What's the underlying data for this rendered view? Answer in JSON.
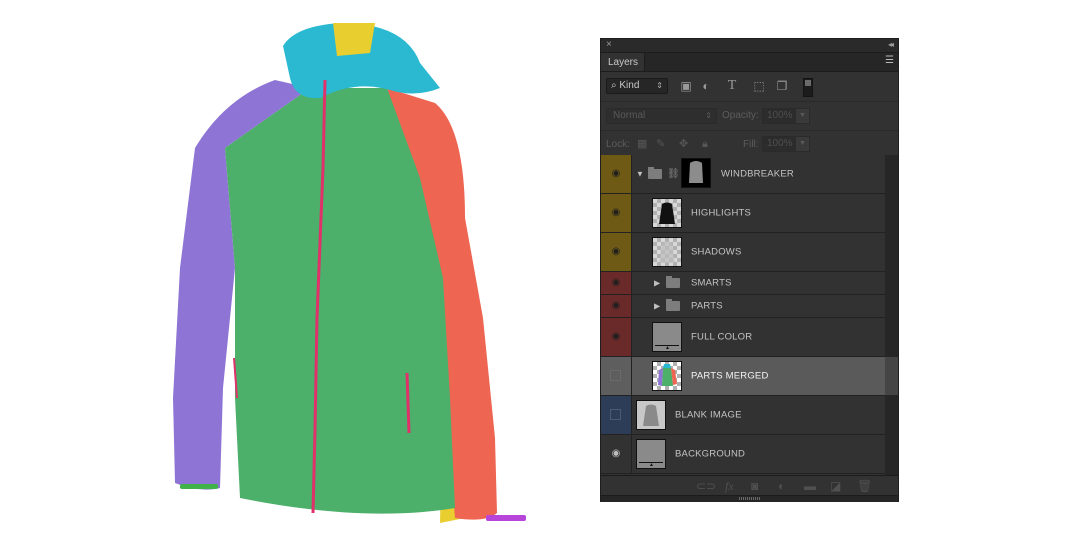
{
  "canvas": {
    "subject": "windbreaker-jacket-mockup",
    "part_colors": {
      "body": "#4CAF6A",
      "left_sleeve": "#8E74D4",
      "right_sleeve": "#EE6552",
      "hood": "#2BB9D2",
      "hood_panel": "#E8CE2E",
      "side_panel": "#E8CE2E",
      "zipper": "#E0316A",
      "cuff_left": "#3FB34A",
      "cuff_right": "#B745D9"
    }
  },
  "panel": {
    "close_icon": "×",
    "collapse_icon": "◂◂",
    "tab_label": "Layers",
    "menu_icon": "☰",
    "filter": {
      "kind_label": "Kind",
      "icons": [
        "image-filter-icon",
        "adjustment-filter-icon",
        "type-filter-icon",
        "shape-filter-icon",
        "smart-object-filter-icon"
      ]
    },
    "blend_mode": "Normal",
    "opacity_label": "Opacity:",
    "opacity_value": "100%",
    "lock_label": "Lock:",
    "fill_label": "Fill:",
    "fill_value": "100%",
    "layers": [
      {
        "name": "WINDBREAKER",
        "type": "group",
        "expanded": true,
        "visible": true,
        "color": "#6E5A14"
      },
      {
        "name": "HIGHLIGHTS",
        "type": "layer",
        "visible": true,
        "color": "#6E5A14"
      },
      {
        "name": "SHADOWS",
        "type": "layer",
        "visible": true,
        "color": "#6E5A14"
      },
      {
        "name": "SMARTS",
        "type": "group",
        "expanded": false,
        "visible": true,
        "color": "#6B2A2A"
      },
      {
        "name": "PARTS",
        "type": "group",
        "expanded": false,
        "visible": true,
        "color": "#6B2A2A"
      },
      {
        "name": "FULL COLOR",
        "type": "fill",
        "visible": true,
        "color": "#6B2A2A"
      },
      {
        "name": "PARTS MERGED",
        "type": "layer",
        "visible": false,
        "selected": true,
        "color": "#5A5A5A"
      },
      {
        "name": "BLANK IMAGE",
        "type": "layer",
        "visible": false,
        "color": "#2D3D57"
      },
      {
        "name": "BACKGROUND",
        "type": "fill",
        "visible": true,
        "color": "#323232"
      }
    ],
    "bottom_icons": [
      "link-layers-icon",
      "fx-icon",
      "add-mask-icon",
      "adjustment-layer-icon",
      "new-group-icon",
      "new-layer-icon",
      "delete-icon"
    ]
  }
}
